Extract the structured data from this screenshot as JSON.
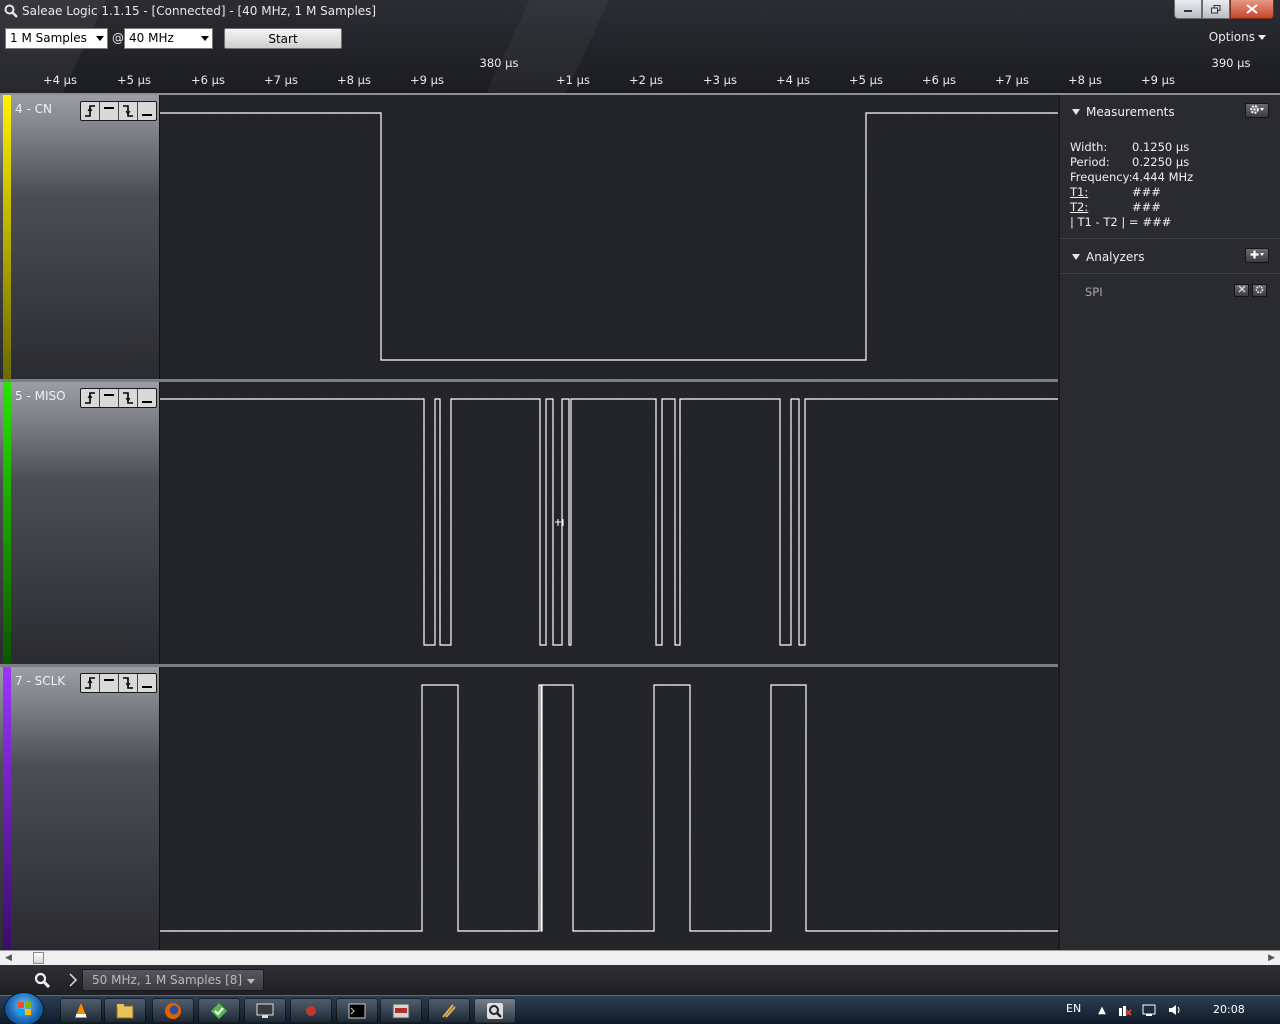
{
  "window": {
    "title": "Saleae Logic 1.1.15 - [Connected] - [40 MHz, 1 M Samples]"
  },
  "toolbar": {
    "samples_value": "1 M Samples",
    "at_sign": "@",
    "rate_value": "40 MHz",
    "start_label": "Start",
    "options_label": "Options"
  },
  "ruler": {
    "major_left": "380 µs",
    "major_right": "390 µs",
    "ticks": [
      "+4 µs",
      "+5 µs",
      "+6 µs",
      "+7 µs",
      "+8 µs",
      "+9 µs",
      "+1 µs",
      "+2 µs",
      "+3 µs",
      "+4 µs",
      "+5 µs",
      "+6 µs",
      "+7 µs",
      "+8 µs",
      "+9 µs"
    ],
    "tick_marks": [
      "⌄",
      "⌄",
      "⌄",
      "⌄",
      "⌄",
      "⌄",
      "⌄",
      "⌄",
      "⌄",
      "⌄",
      "⌄",
      "⌄",
      "⌄",
      "⌄",
      "⌄",
      "⌄",
      "⌄"
    ]
  },
  "channels": [
    {
      "name": "4 - CN",
      "color": "#e8e000",
      "trigger_buttons": [
        "rising-edge",
        "high",
        "falling-edge",
        "low"
      ]
    },
    {
      "name": "5 - MISO",
      "color": "#19c800",
      "trigger_buttons": [
        "rising-edge",
        "high",
        "falling-edge",
        "low"
      ]
    },
    {
      "name": "7 - SCLK",
      "color": "#7a1fd6",
      "trigger_buttons": [
        "rising-edge",
        "high",
        "falling-edge",
        "low"
      ]
    }
  ],
  "measurements": {
    "header": "Measurements",
    "width_label": "Width:",
    "width_value": "0.1250 µs",
    "period_label": "Period:",
    "period_value": "0.2250 µs",
    "frequency_label": "Frequency:",
    "frequency_value": "4.444 MHz",
    "t1_label": "T1:",
    "t1_value": "###",
    "t2_label": "T2:",
    "t2_value": "###",
    "diff_label": "| T1 - T2 | =",
    "diff_value": "###"
  },
  "analyzers": {
    "header": "Analyzers",
    "items": [
      {
        "label": "SPI"
      }
    ]
  },
  "session": {
    "tab_label": "50 MHz, 1 M Samples [8]"
  },
  "taskbar": {
    "language": "EN",
    "clock": "20:08",
    "apps": [
      "vlc-icon",
      "explorer-icon",
      "firefox-icon",
      "app-icon",
      "remote-desktop-icon",
      "app-icon",
      "cmd-icon",
      "ols-icon",
      "app-icon",
      "saleae-icon"
    ]
  }
}
